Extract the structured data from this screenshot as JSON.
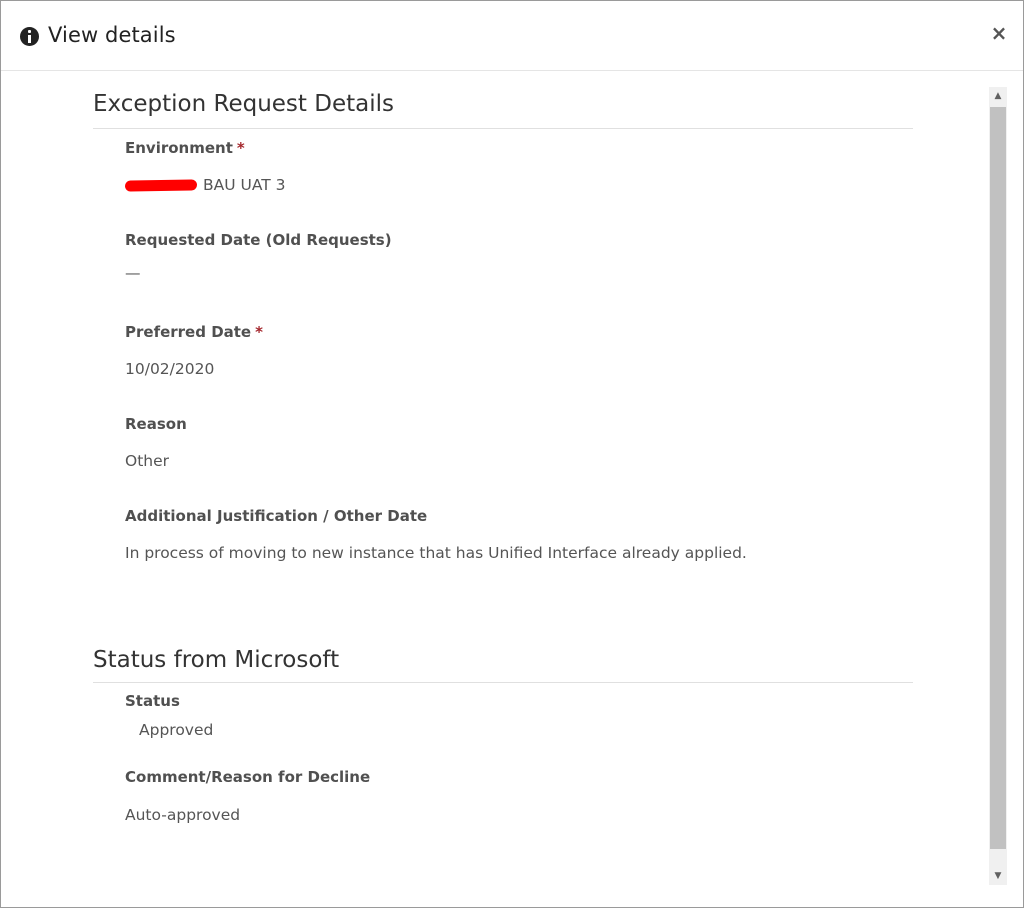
{
  "dialog": {
    "title": "View details",
    "close_label": "×"
  },
  "sections": [
    {
      "title": "Exception Request Details",
      "fields": [
        {
          "label": "Environment",
          "required": true,
          "value": "BAU UAT 3",
          "redacted_prefix": true
        },
        {
          "label": "Requested Date (Old Requests)",
          "required": false,
          "value": "—"
        },
        {
          "label": "Preferred Date",
          "required": true,
          "value": "10/02/2020"
        },
        {
          "label": "Reason",
          "required": false,
          "value": "Other"
        },
        {
          "label": "Additional Justification / Other Date",
          "required": false,
          "value": "In process of moving to new instance that has Unified Interface already applied."
        }
      ]
    },
    {
      "title": "Status from Microsoft",
      "fields": [
        {
          "label": "Status",
          "required": false,
          "value": "Approved"
        },
        {
          "label": "Comment/Reason for Decline",
          "required": false,
          "value": "Auto-approved"
        }
      ]
    }
  ],
  "required_marker": "*",
  "scrollbar": {
    "up_glyph": "▲",
    "down_glyph": "▼"
  },
  "colors": {
    "required": "#a4262c",
    "redaction": "#ff0000"
  }
}
